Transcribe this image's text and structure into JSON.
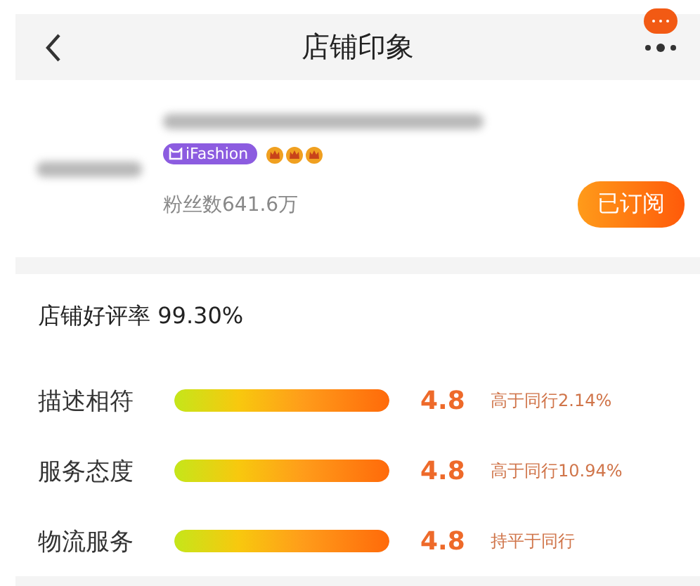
{
  "header": {
    "title": "店铺印象"
  },
  "shop": {
    "badge": "iFashion",
    "stars": 3,
    "fans": "粉丝数641.6万",
    "subscribe_button": {
      "label": "已订阅",
      "subscribed": true
    }
  },
  "ratings": {
    "summary": "店铺好评率 99.30%",
    "items": [
      {
        "label": "描述相符",
        "level": 1,
        "score": "4.8",
        "comparison": "高于同行2.14%"
      },
      {
        "label": "服务态度",
        "level": 1,
        "score": "4.8",
        "comparison": "高于同行10.94%"
      },
      {
        "label": "物流服务",
        "level": 1,
        "score": "4.8",
        "comparison": "持平于同行"
      }
    ]
  }
}
